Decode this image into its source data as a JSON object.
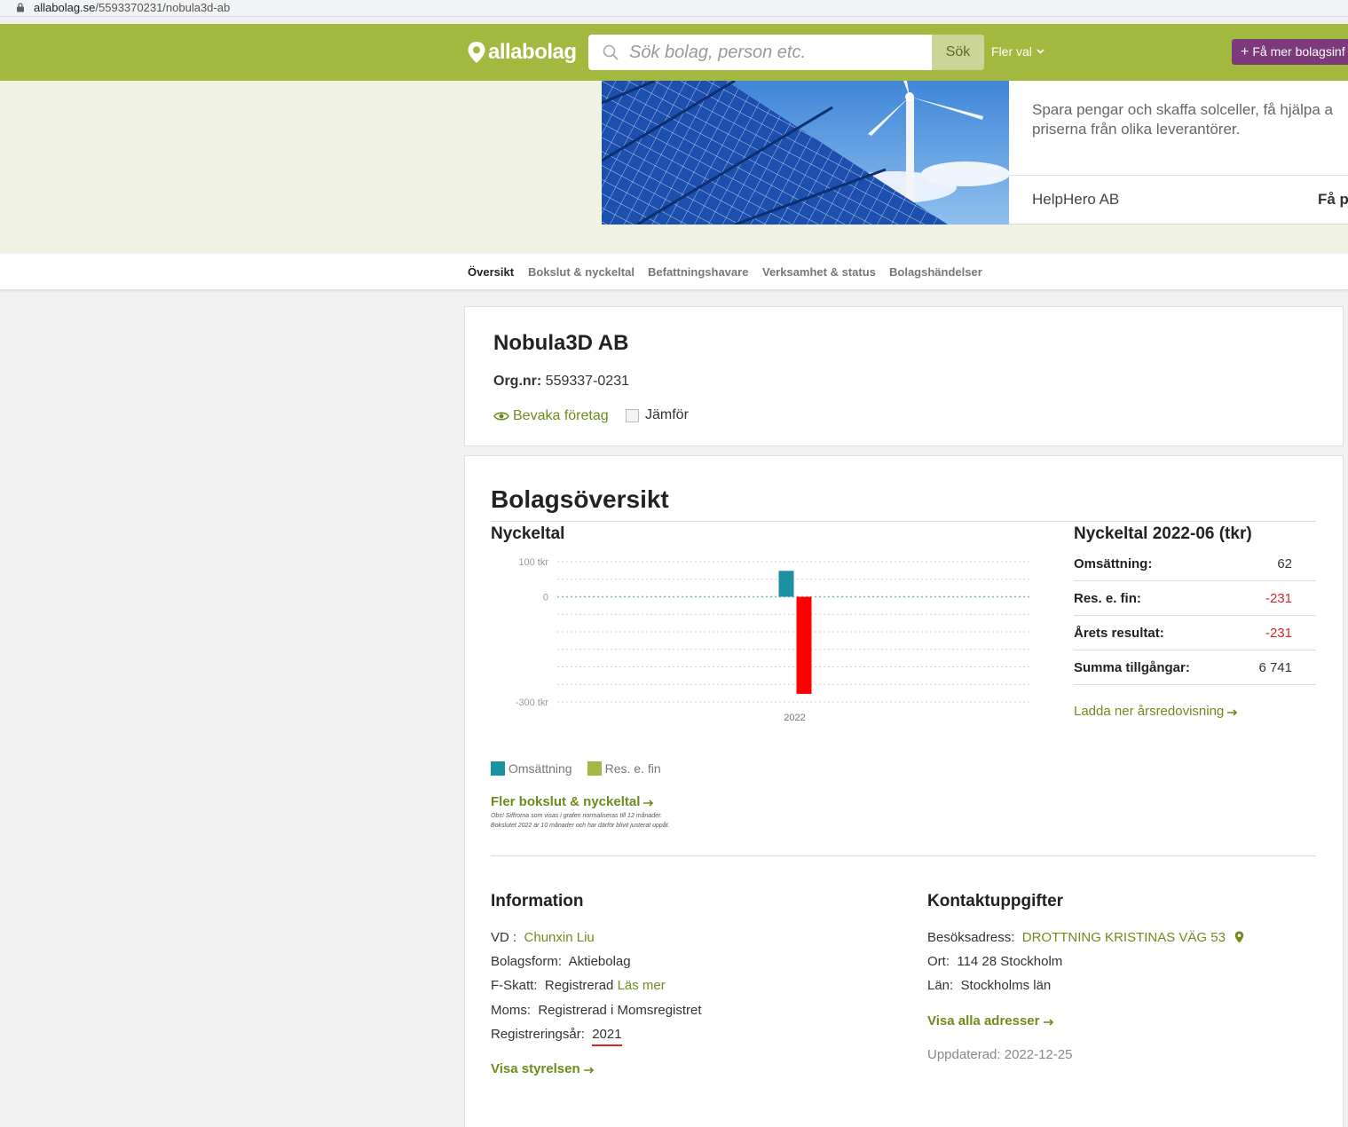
{
  "browser": {
    "url_host": "allabolag.se",
    "url_path": "/5593370231/nobula3d-ab"
  },
  "header": {
    "logo_text": "allabolag",
    "search_placeholder": "Sök bolag, person etc.",
    "search_button": "Sök",
    "more_menu": "Fler val",
    "cta_label": "Få mer bolagsinf"
  },
  "ad": {
    "description_line1": "Spara pengar och skaffa solceller, få hjälpa a",
    "description_line2": "priserna från olika leverantörer.",
    "company": "HelpHero AB",
    "cta": "Få p"
  },
  "nav": {
    "tabs": [
      {
        "label": "Översikt",
        "active": true
      },
      {
        "label": "Bokslut & nyckeltal",
        "active": false
      },
      {
        "label": "Befattningshavare",
        "active": false
      },
      {
        "label": "Verksamhet & status",
        "active": false
      },
      {
        "label": "Bolagshändelser",
        "active": false
      }
    ]
  },
  "company": {
    "name": "Nobula3D AB",
    "orgnr_label": "Org.nr:",
    "orgnr": "559337-0231",
    "watch_label": "Bevaka företag",
    "compare_label": "Jämför"
  },
  "overview": {
    "title": "Bolagsöversikt",
    "chart_title": "Nyckeltal",
    "legend": [
      {
        "label": "Omsättning",
        "color": "#1a90a3"
      },
      {
        "label": "Res. e. fin",
        "color": "#a3b83f"
      }
    ],
    "more_link": "Fler bokslut & nyckeltal",
    "note_line1": "Obs! Siffrorna som visas i grafen normaliseras till 12 månader.",
    "note_line2": "Bokslutet 2022 är 10 månader och har därför blivit justerat uppåt."
  },
  "chart_data": {
    "type": "bar",
    "categories": [
      "2022"
    ],
    "series": [
      {
        "name": "Omsättning",
        "values": [
          74
        ],
        "color": "#1a90a3"
      },
      {
        "name": "Res. e. fin",
        "values": [
          -277
        ],
        "color": "#ff0000"
      }
    ],
    "y_tick_labels": [
      "100 tkr",
      "0",
      "-300 tkr"
    ],
    "ylim": [
      -300,
      100
    ],
    "grid": true
  },
  "keyfigures": {
    "title": "Nyckeltal 2022-06 (tkr)",
    "rows": [
      {
        "label": "Omsättning:",
        "value": "62",
        "negative": false
      },
      {
        "label": "Res. e. fin:",
        "value": "-231",
        "negative": true
      },
      {
        "label": "Årets resultat:",
        "value": "-231",
        "negative": true
      },
      {
        "label": "Summa tillgångar:",
        "value": "6 741",
        "negative": false
      }
    ],
    "download_link": "Ladda ner årsredovisning"
  },
  "information": {
    "title": "Information",
    "vd_label": "VD :",
    "vd_value": "Chunxin Liu",
    "form_label": "Bolagsform:",
    "form_value": "Aktiebolag",
    "fskatt_label": "F-Skatt:",
    "fskatt_value": "Registrerad",
    "fskatt_link": "Läs mer",
    "moms_label": "Moms:",
    "moms_value": "Registrerad i Momsregistret",
    "regyear_label": "Registreringsår:",
    "regyear_value": "2021",
    "board_link": "Visa styrelsen"
  },
  "contact": {
    "title": "Kontaktuppgifter",
    "address_label": "Besöksadress:",
    "address_value": "DROTTNING KRISTINAS VÄG 53",
    "city_label": "Ort:",
    "city_value": "114 28 Stockholm",
    "county_label": "Län:",
    "county_value": "Stockholms län",
    "all_addresses_link": "Visa alla adresser",
    "updated": "Uppdaterad: 2022-12-25"
  }
}
